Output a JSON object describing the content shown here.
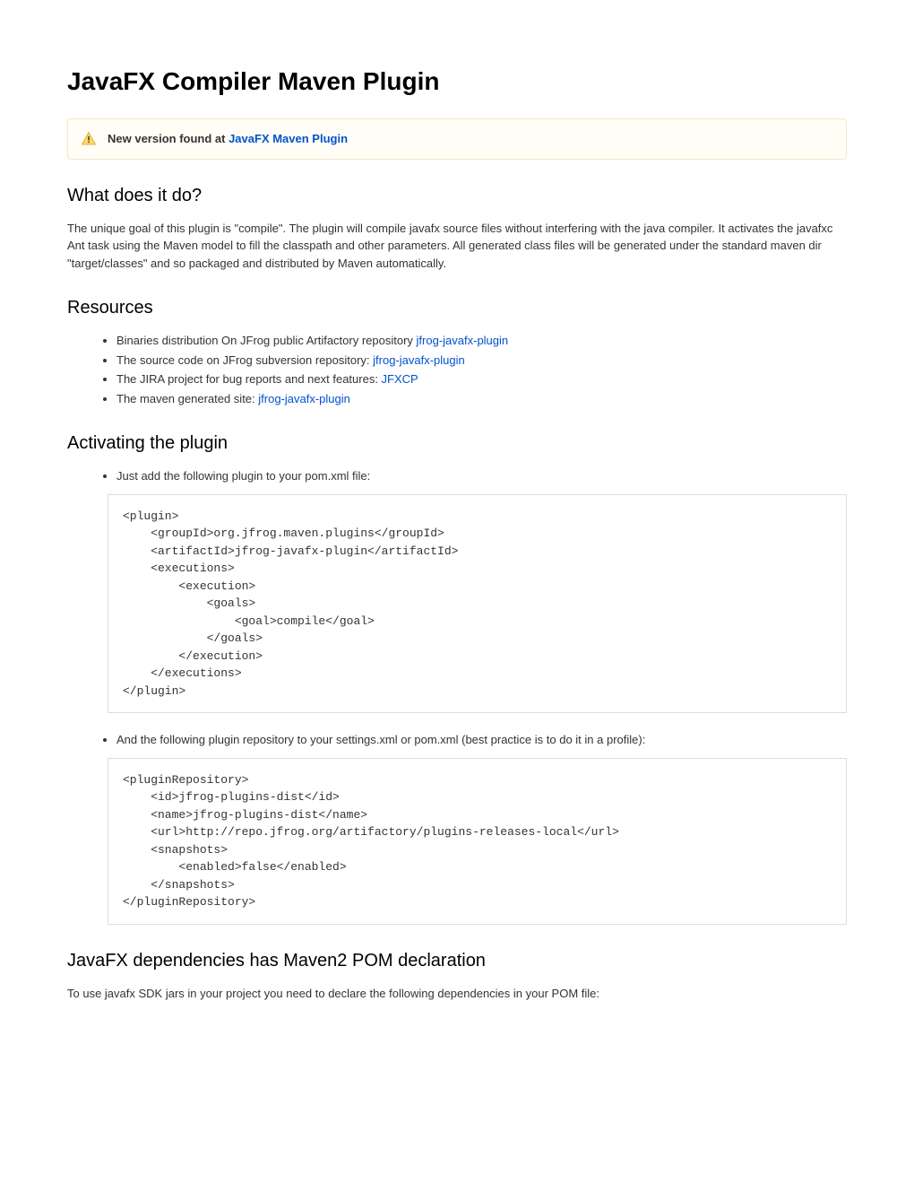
{
  "title": "JavaFX Compiler Maven Plugin",
  "panel": {
    "prefix": "New version found at ",
    "link": "JavaFX Maven Plugin"
  },
  "sections": {
    "whatItDoes": {
      "heading": "What does it do?",
      "text": "The unique goal of this plugin is \"compile\". The plugin will compile javafx source files without interfering with the java compiler. It activates the javafxc Ant task using the Maven model to fill the classpath and other parameters. All generated class files will be generated under the standard maven dir \"target/classes\" and so packaged and distributed by Maven automatically."
    },
    "resources": {
      "heading": "Resources",
      "items": [
        {
          "text": "Binaries distribution On JFrog public Artifactory repository ",
          "link": "jfrog-javafx-plugin"
        },
        {
          "text": "The source code on JFrog subversion repository: ",
          "link": "jfrog-javafx-plugin"
        },
        {
          "text": "The JIRA project for bug reports and next features: ",
          "link": "JFXCP"
        },
        {
          "text": "The maven generated site: ",
          "link": "jfrog-javafx-plugin"
        }
      ]
    },
    "activating": {
      "heading": "Activating the plugin",
      "step1": "Just add the following plugin to your pom.xml file:",
      "code1": "<plugin>\n    <groupId>org.jfrog.maven.plugins</groupId>\n    <artifactId>jfrog-javafx-plugin</artifactId>\n    <executions>\n        <execution>\n            <goals>\n                <goal>compile</goal>\n            </goals>\n        </execution>\n    </executions>\n</plugin>",
      "step2": "And the following plugin repository to your settings.xml or pom.xml (best practice is to do it in a profile):",
      "code2": "<pluginRepository>\n    <id>jfrog-plugins-dist</id>\n    <name>jfrog-plugins-dist</name>\n    <url>http://repo.jfrog.org/artifactory/plugins-releases-local</url>\n    <snapshots>\n        <enabled>false</enabled>\n    </snapshots>\n</pluginRepository>"
    },
    "dependencies": {
      "heading": "JavaFX dependencies has Maven2 POM declaration",
      "text": "To use javafx SDK jars in your project you need to declare the following dependencies in your POM file:"
    }
  }
}
